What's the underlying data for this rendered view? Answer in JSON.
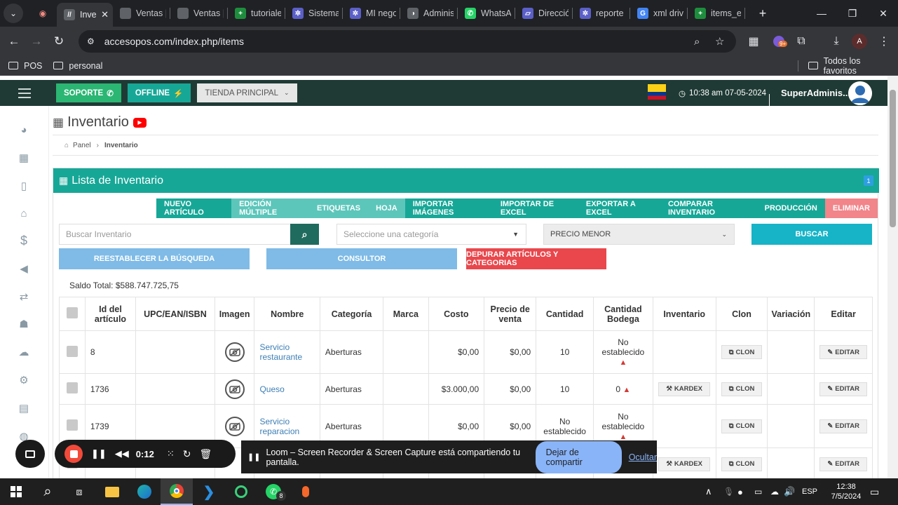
{
  "browser": {
    "tabs": [
      {
        "title": "Inve",
        "color": "#5f6368",
        "glyph": "//",
        "active": true
      },
      {
        "title": "Ventas |",
        "color": "#5f6368",
        "glyph": ""
      },
      {
        "title": "Ventas |",
        "color": "#5f6368",
        "glyph": ""
      },
      {
        "title": "tutoriale",
        "color": "#1e8e3e",
        "glyph": "+"
      },
      {
        "title": "Sistema",
        "color": "#5b5fc7",
        "glyph": "✲"
      },
      {
        "title": "MI nego",
        "color": "#5b5fc7",
        "glyph": "✲"
      },
      {
        "title": "Adminis",
        "color": "#5f6368",
        "glyph": "◑"
      },
      {
        "title": "WhatsA",
        "color": "#25d366",
        "glyph": "✆"
      },
      {
        "title": "Direcció",
        "color": "#5b5fc7",
        "glyph": "▱"
      },
      {
        "title": "reporte",
        "color": "#5b5fc7",
        "glyph": "✲"
      },
      {
        "title": "xml driv",
        "color": "#4285f4",
        "glyph": "G"
      },
      {
        "title": "items_e",
        "color": "#1e8e3e",
        "glyph": "+"
      }
    ],
    "url": "accesopos.com/index.php/items",
    "bookmarks": [
      "POS",
      "personal"
    ],
    "all_bookmarks": "Todos los favoritos",
    "ext_badge": "9+",
    "profile": "A"
  },
  "topnav": {
    "soporte": "SOPORTE",
    "offline": "OFFLINE",
    "tienda": "TIENDA PRINCIPAL",
    "clock": "10:38 am 07-05-2024",
    "user": "SuperAdminis...",
    "colors": {
      "soporte": "#2bb673",
      "offline": "#17a797",
      "tienda": "#e6e6e6"
    }
  },
  "page": {
    "title": "Inventario",
    "breadcrumb_home": "Panel",
    "breadcrumb_current": "Inventario",
    "panel_title": "Lista de Inventario",
    "panel_badge": "1",
    "actions": [
      "NUEVO ARTÍCULO",
      "EDICIÓN MÚLTIPLE",
      "ETIQUETAS",
      "HOJA",
      "IMPORTAR IMÁGENES",
      "IMPORTAR DE EXCEL",
      "EXPORTAR A EXCEL",
      "COMPARAR INVENTARIO",
      "PRODUCCIÓN",
      "ELIMINAR"
    ],
    "search_placeholder": "Buscar Inventario",
    "category_placeholder": "Seleccione una categoría",
    "price_order": "PRECIO MENOR",
    "buscar": "BUSCAR",
    "reset": "REESTABLECER LA BÚSQUEDA",
    "consultor": "CONSULTOR",
    "depurar": "DEPURAR ARTÍCULOS Y CATEGORIAS",
    "saldo_label": "Saldo Total:",
    "saldo_value": "$588.747.725,75"
  },
  "table": {
    "headers": [
      "Id del artículo",
      "UPC/EAN/ISBN",
      "Imagen",
      "Nombre",
      "Categoría",
      "Marca",
      "Costo",
      "Precio de venta",
      "Cantidad",
      "Cantidad Bodega",
      "Inventario",
      "Clon",
      "Variación",
      "Editar"
    ],
    "rows": [
      {
        "id": "8",
        "nombre": "Servicio restaurante",
        "categoria": "Aberturas",
        "costo": "$0,00",
        "precio": "$0,00",
        "cantidad": "10",
        "bodega": "No establecido",
        "bodega_warn": true,
        "kardex": "",
        "clon": "CLON",
        "editar": "EDITAR"
      },
      {
        "id": "1736",
        "nombre": "Queso",
        "categoria": "Aberturas",
        "costo": "$3.000,00",
        "precio": "$0,00",
        "cantidad": "10",
        "bodega": "0",
        "bodega_warn": true,
        "kardex": "KARDEX",
        "clon": "CLON",
        "editar": "EDITAR"
      },
      {
        "id": "1739",
        "nombre": "Servicio reparacion",
        "categoria": "Aberturas",
        "costo": "$0,00",
        "precio": "$0,00",
        "cantidad": "No establecido",
        "bodega": "No establecido",
        "bodega_warn": true,
        "kardex": "",
        "clon": "CLON",
        "editar": "EDITAR"
      },
      {
        "id": "",
        "nombre": "",
        "categoria": "",
        "costo": "",
        "precio": "",
        "cantidad": "",
        "bodega": "",
        "bodega_warn": false,
        "kardex": "KARDEX",
        "clon": "CLON",
        "editar": "EDITAR"
      }
    ]
  },
  "loom": {
    "timer": "0:12",
    "message": "Loom – Screen Recorder & Screen Capture está compartiendo tu pantalla.",
    "stop_sharing": "Dejar de compartir",
    "hide": "Ocultar"
  },
  "taskbar": {
    "lang": "ESP",
    "time": "12:38",
    "date": "7/5/2024",
    "whatsapp_badge": "8"
  }
}
